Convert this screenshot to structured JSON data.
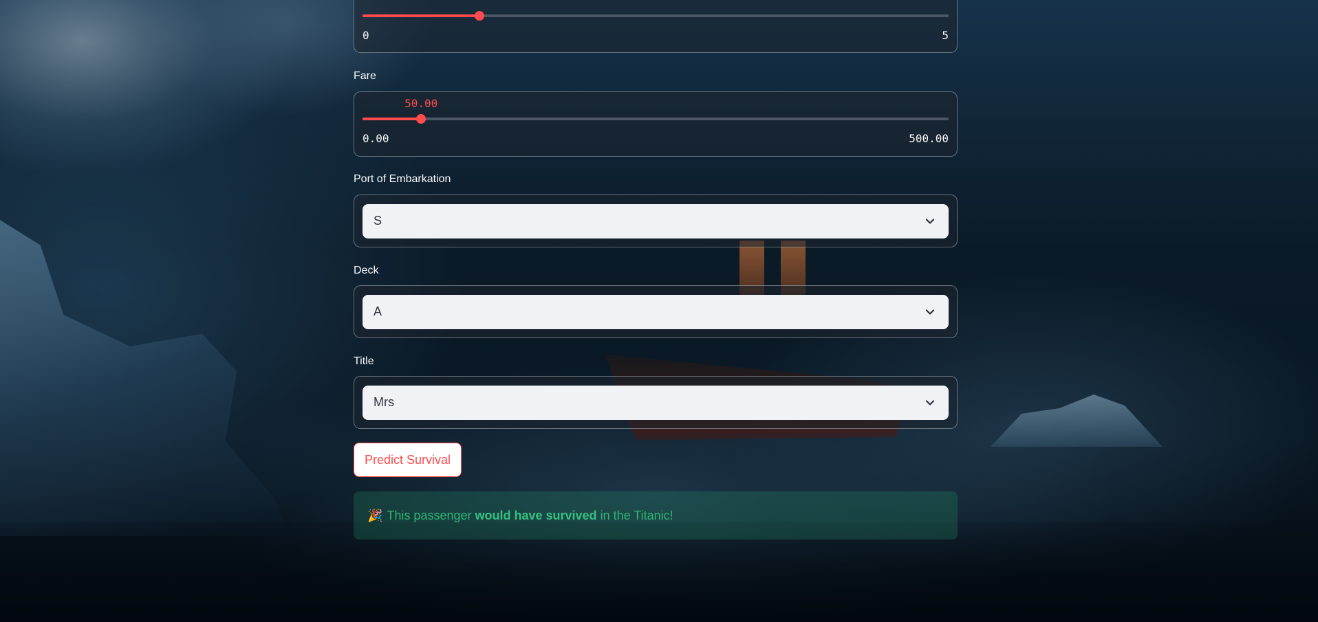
{
  "colors": {
    "accent": "#ff4b4b",
    "select_bg": "#f0f2f6",
    "success_text": "#2fb573"
  },
  "parch_slider": {
    "value": "1",
    "min": "0",
    "max": "5",
    "fraction": 0.2
  },
  "fare_slider": {
    "label": "Fare",
    "value": "50.00",
    "min": "0.00",
    "max": "500.00",
    "fraction": 0.1
  },
  "embarkation": {
    "label": "Port of Embarkation",
    "value": "S",
    "icon": "chevron-down-icon"
  },
  "deck": {
    "label": "Deck",
    "value": "A",
    "icon": "chevron-down-icon"
  },
  "title_select": {
    "label": "Title",
    "value": "Mrs",
    "icon": "chevron-down-icon"
  },
  "predict_button": {
    "label": "Predict Survival"
  },
  "result": {
    "emoji": "🎉",
    "prefix": "This passenger ",
    "strong": "would have survived",
    "suffix": " in the Titanic!"
  }
}
